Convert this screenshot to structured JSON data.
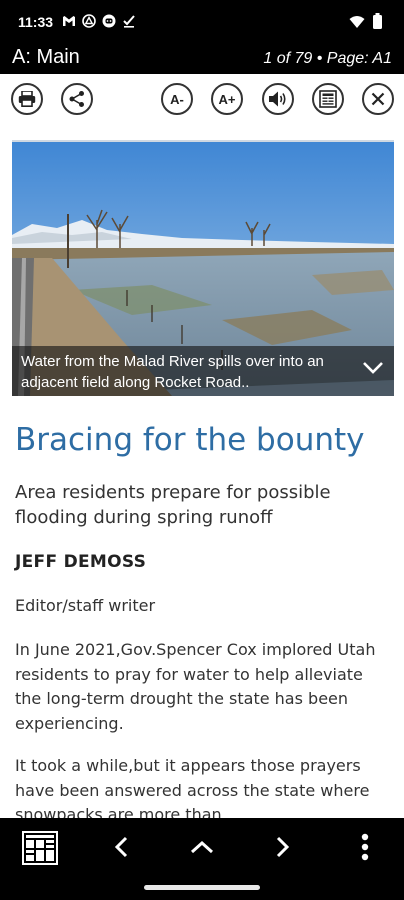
{
  "status_bar": {
    "time": "11:33",
    "left_icons": [
      "gmail-icon",
      "drive-icon",
      "discord-icon",
      "checkmark-icon"
    ],
    "right_icons": [
      "wifi-icon",
      "battery-icon"
    ]
  },
  "title_bar": {
    "section": "A: Main",
    "page_info": "1 of 79 • Page: A1"
  },
  "toolbar": {
    "buttons": [
      {
        "name": "print-button",
        "icon": "printer-icon"
      },
      {
        "name": "share-button",
        "icon": "share-icon"
      },
      {
        "name": "font-decrease-button",
        "label": "A-"
      },
      {
        "name": "font-increase-button",
        "label": "A+"
      },
      {
        "name": "read-aloud-button",
        "icon": "speaker-icon"
      },
      {
        "name": "page-view-button",
        "icon": "newspaper-icon"
      },
      {
        "name": "close-button",
        "icon": "close-icon"
      }
    ]
  },
  "article": {
    "photo_caption": "Water from the Malad River spills over into an adjacent field along Rocket Road..",
    "headline": "Bracing for the bounty",
    "deck": "Area residents prepare for possible flooding during spring runoff",
    "byline": "JEFF DEMOSS",
    "role": "Editor/staff writer",
    "paragraphs": [
      "In June 2021,Gov.Spencer Cox implored Utah residents to pray for water to help alleviate the long-term drought the state has been experiencing.",
      "It took a while,but it appears those prayers have been answered across the state where snowpacks are more than"
    ]
  },
  "bottom_nav": {
    "items": [
      "thumbnails-icon",
      "previous-icon",
      "up-icon",
      "next-icon",
      "more-icon"
    ]
  },
  "colors": {
    "headline": "#2e6da4",
    "bars": "#000000",
    "content_bg": "#ffffff"
  }
}
